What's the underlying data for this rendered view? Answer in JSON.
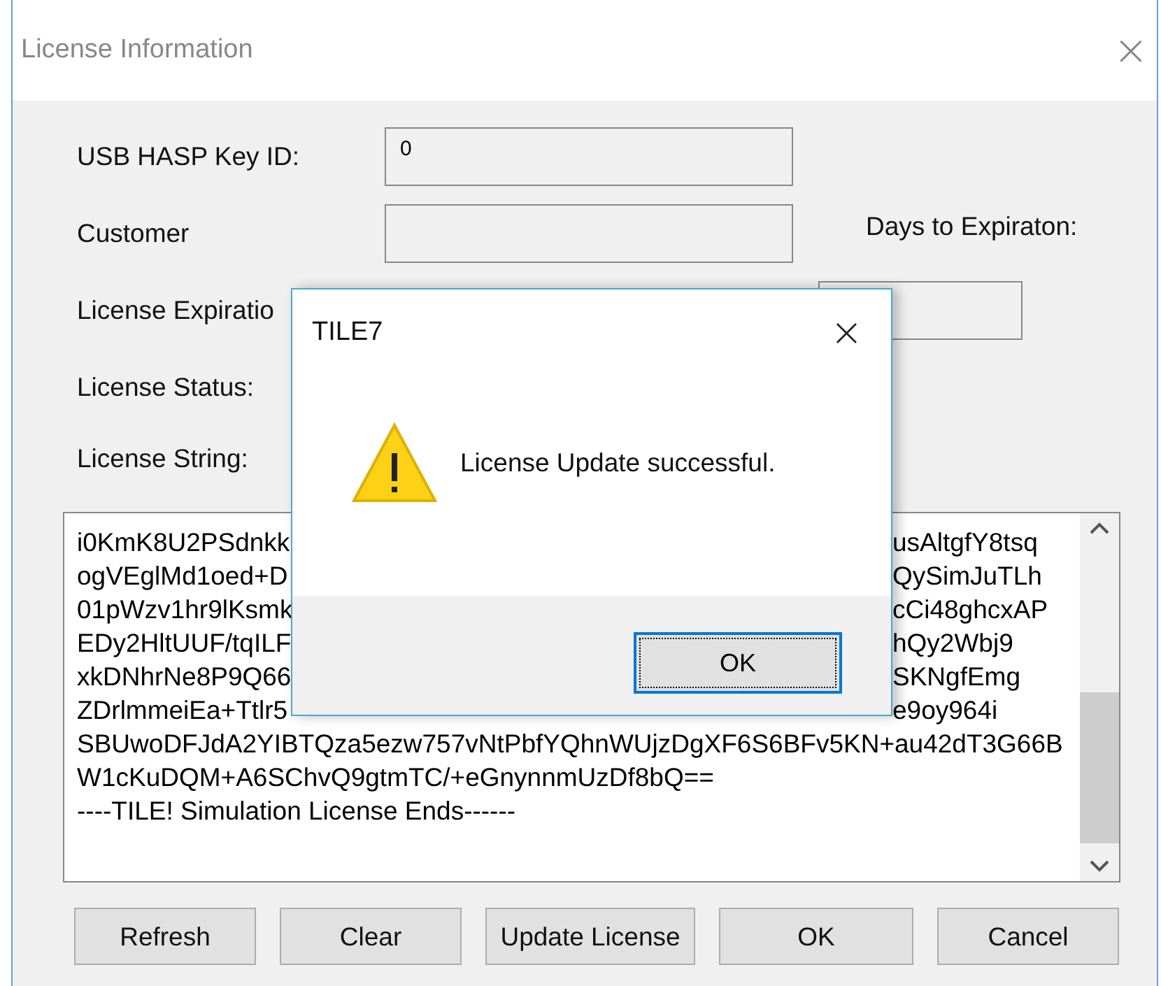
{
  "window": {
    "title": "License Information",
    "close": "×"
  },
  "fields": [
    {
      "label": "USB HASP Key ID:",
      "value": "0"
    },
    {
      "label": "Customer"
    }
  ],
  "expiration_label": "License Expiratio",
  "status_label": "License Status:",
  "days": {
    "label": "Days to Expiraton:"
  },
  "license_string": {
    "label": "License String:",
    "lines": [
      {
        "start": "i0KmK8U2PSdnkk",
        "end": "usAltgfY8tsq"
      },
      {
        "start": "ogVEglMd1oed+D",
        "end": "QySimJuTLh"
      },
      {
        "start": "01pWzv1hr9lKsmk",
        "end": "cCi48ghcxAP"
      },
      {
        "start": "EDy2HltUUF/tqILF",
        "end": "hQy2Wbj9"
      },
      {
        "start": "xkDNhrNe8P9Q66",
        "end": "SKNgfEmg"
      },
      {
        "start": "ZDrlmmeiEa+Ttlr5",
        "end": "e9oy964i"
      },
      {
        "start": "SBUwoDFJdA2YIBTQza5ezw757vNtPbfYQhnWUjzDgXF6S6BFv5KN+au42dT3G66B"
      },
      {
        "start": "W1cKuDQM+A6SChvQ9gtmTC/+eGnynnmUzDf8bQ=="
      },
      {
        "start": "----TILE! Simulation License Ends------"
      }
    ]
  },
  "buttons": [
    "Refresh",
    "Clear",
    "Update License",
    "OK",
    "Cancel"
  ],
  "dialog": {
    "title": "TILE7",
    "close": "×",
    "message": "License Update successful.",
    "button": "OK"
  }
}
